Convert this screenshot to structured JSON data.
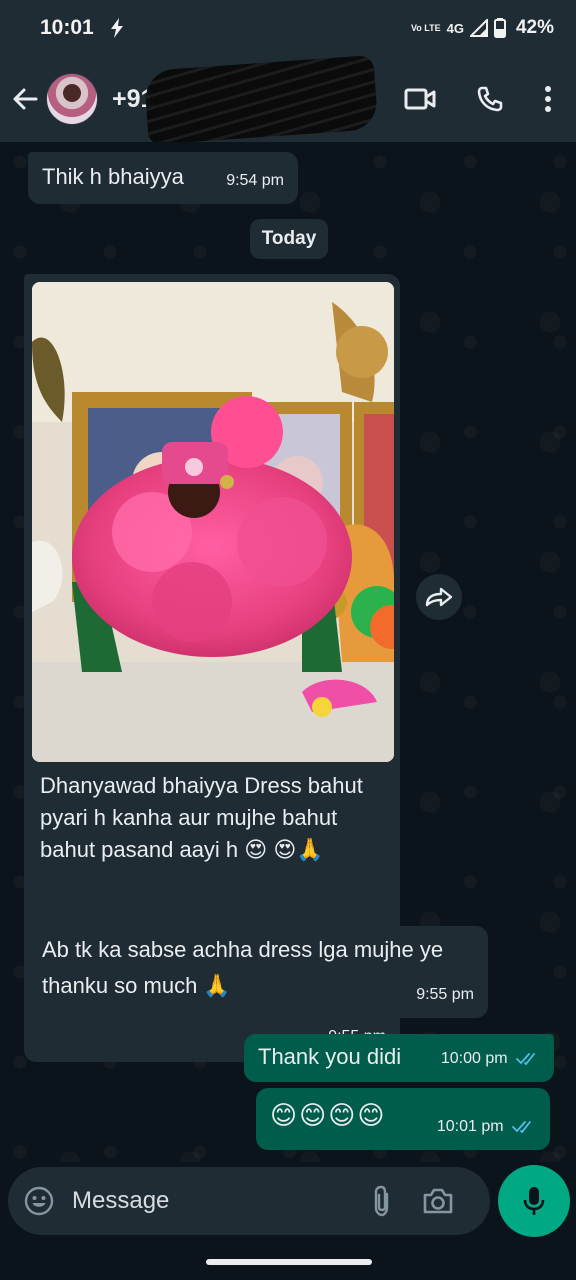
{
  "status_bar": {
    "time": "10:01",
    "volte_label": "Vo LTE",
    "network": "4G",
    "battery": "42%"
  },
  "header": {
    "contact_name": "+91"
  },
  "messages": [
    {
      "direction": "in",
      "text": "Thik h bhaiyya",
      "time": "9:54 pm"
    },
    {
      "direction": "in",
      "type": "image",
      "text": "Dhanyawad bhaiyya Dress bahut pyari h  kanha aur mujhe bahut bahut pasand aayi h 😍 😍🙏",
      "time": "9:55 pm"
    },
    {
      "direction": "in",
      "text": "Ab tk ka sabse achha dress lga mujhe ye thanku so much 🙏",
      "time": "9:55 pm"
    },
    {
      "direction": "out",
      "text": "Thank you didi",
      "time": "10:00 pm",
      "status": "read"
    },
    {
      "direction": "out",
      "text": "😊😊😊😊",
      "time": "10:01 pm",
      "status": "read"
    }
  ],
  "date_separator": "Today",
  "composer": {
    "placeholder": "Message"
  },
  "colors": {
    "background": "#0b141a",
    "bar": "#1f2c34",
    "incoming_bubble": "#1f2c34",
    "outgoing_bubble": "#005c4b",
    "accent": "#00a884",
    "read_ticks": "#53bdeb"
  }
}
